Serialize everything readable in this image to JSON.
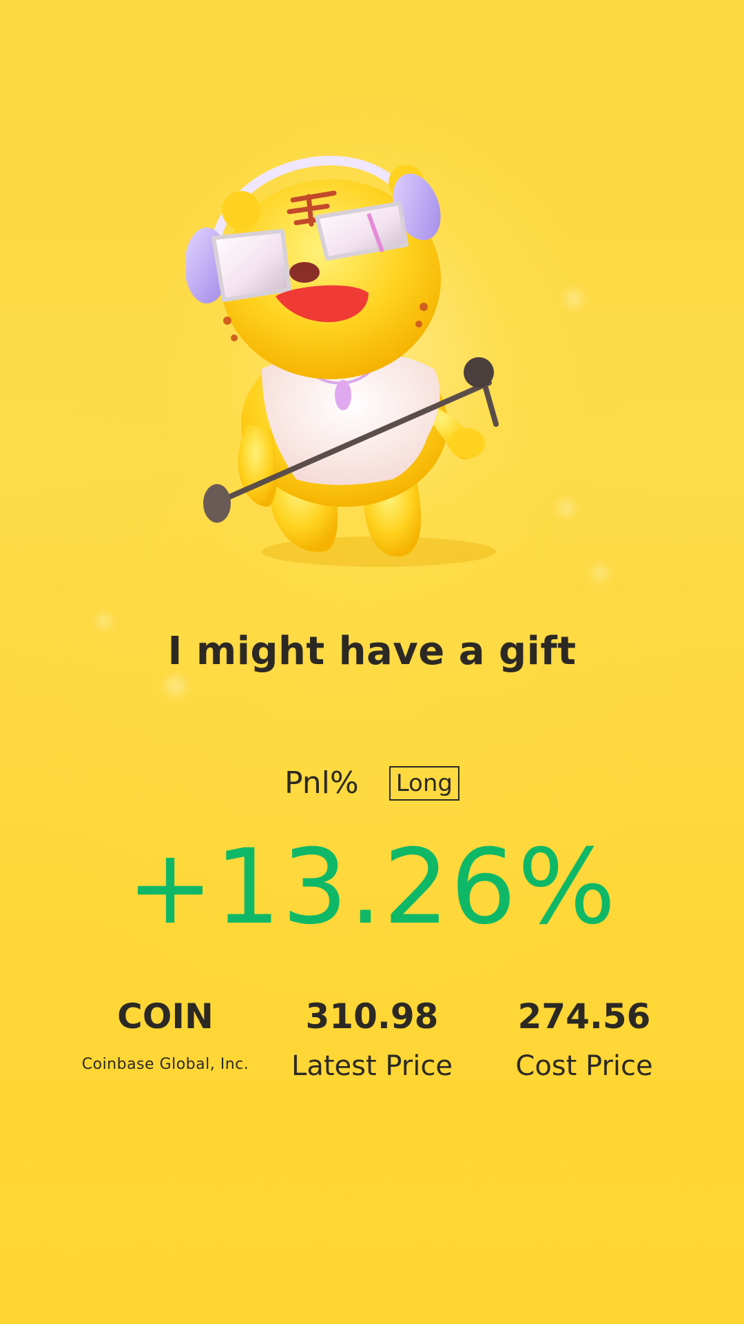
{
  "headline": "I might have a gift",
  "pnl": {
    "label": "Pnl%",
    "direction": "Long",
    "value": "+13.26%",
    "color": "#0fb867"
  },
  "stock": {
    "ticker": "COIN",
    "company": "Coinbase Global, Inc."
  },
  "latest": {
    "value": "310.98",
    "label": "Latest Price"
  },
  "cost": {
    "value": "274.56",
    "label": "Cost Price"
  },
  "colors": {
    "background": "#fdd940",
    "text": "#2c2924",
    "positive": "#0fb867"
  },
  "mascot": {
    "icon": "tiger-dj-mascot-icon"
  }
}
